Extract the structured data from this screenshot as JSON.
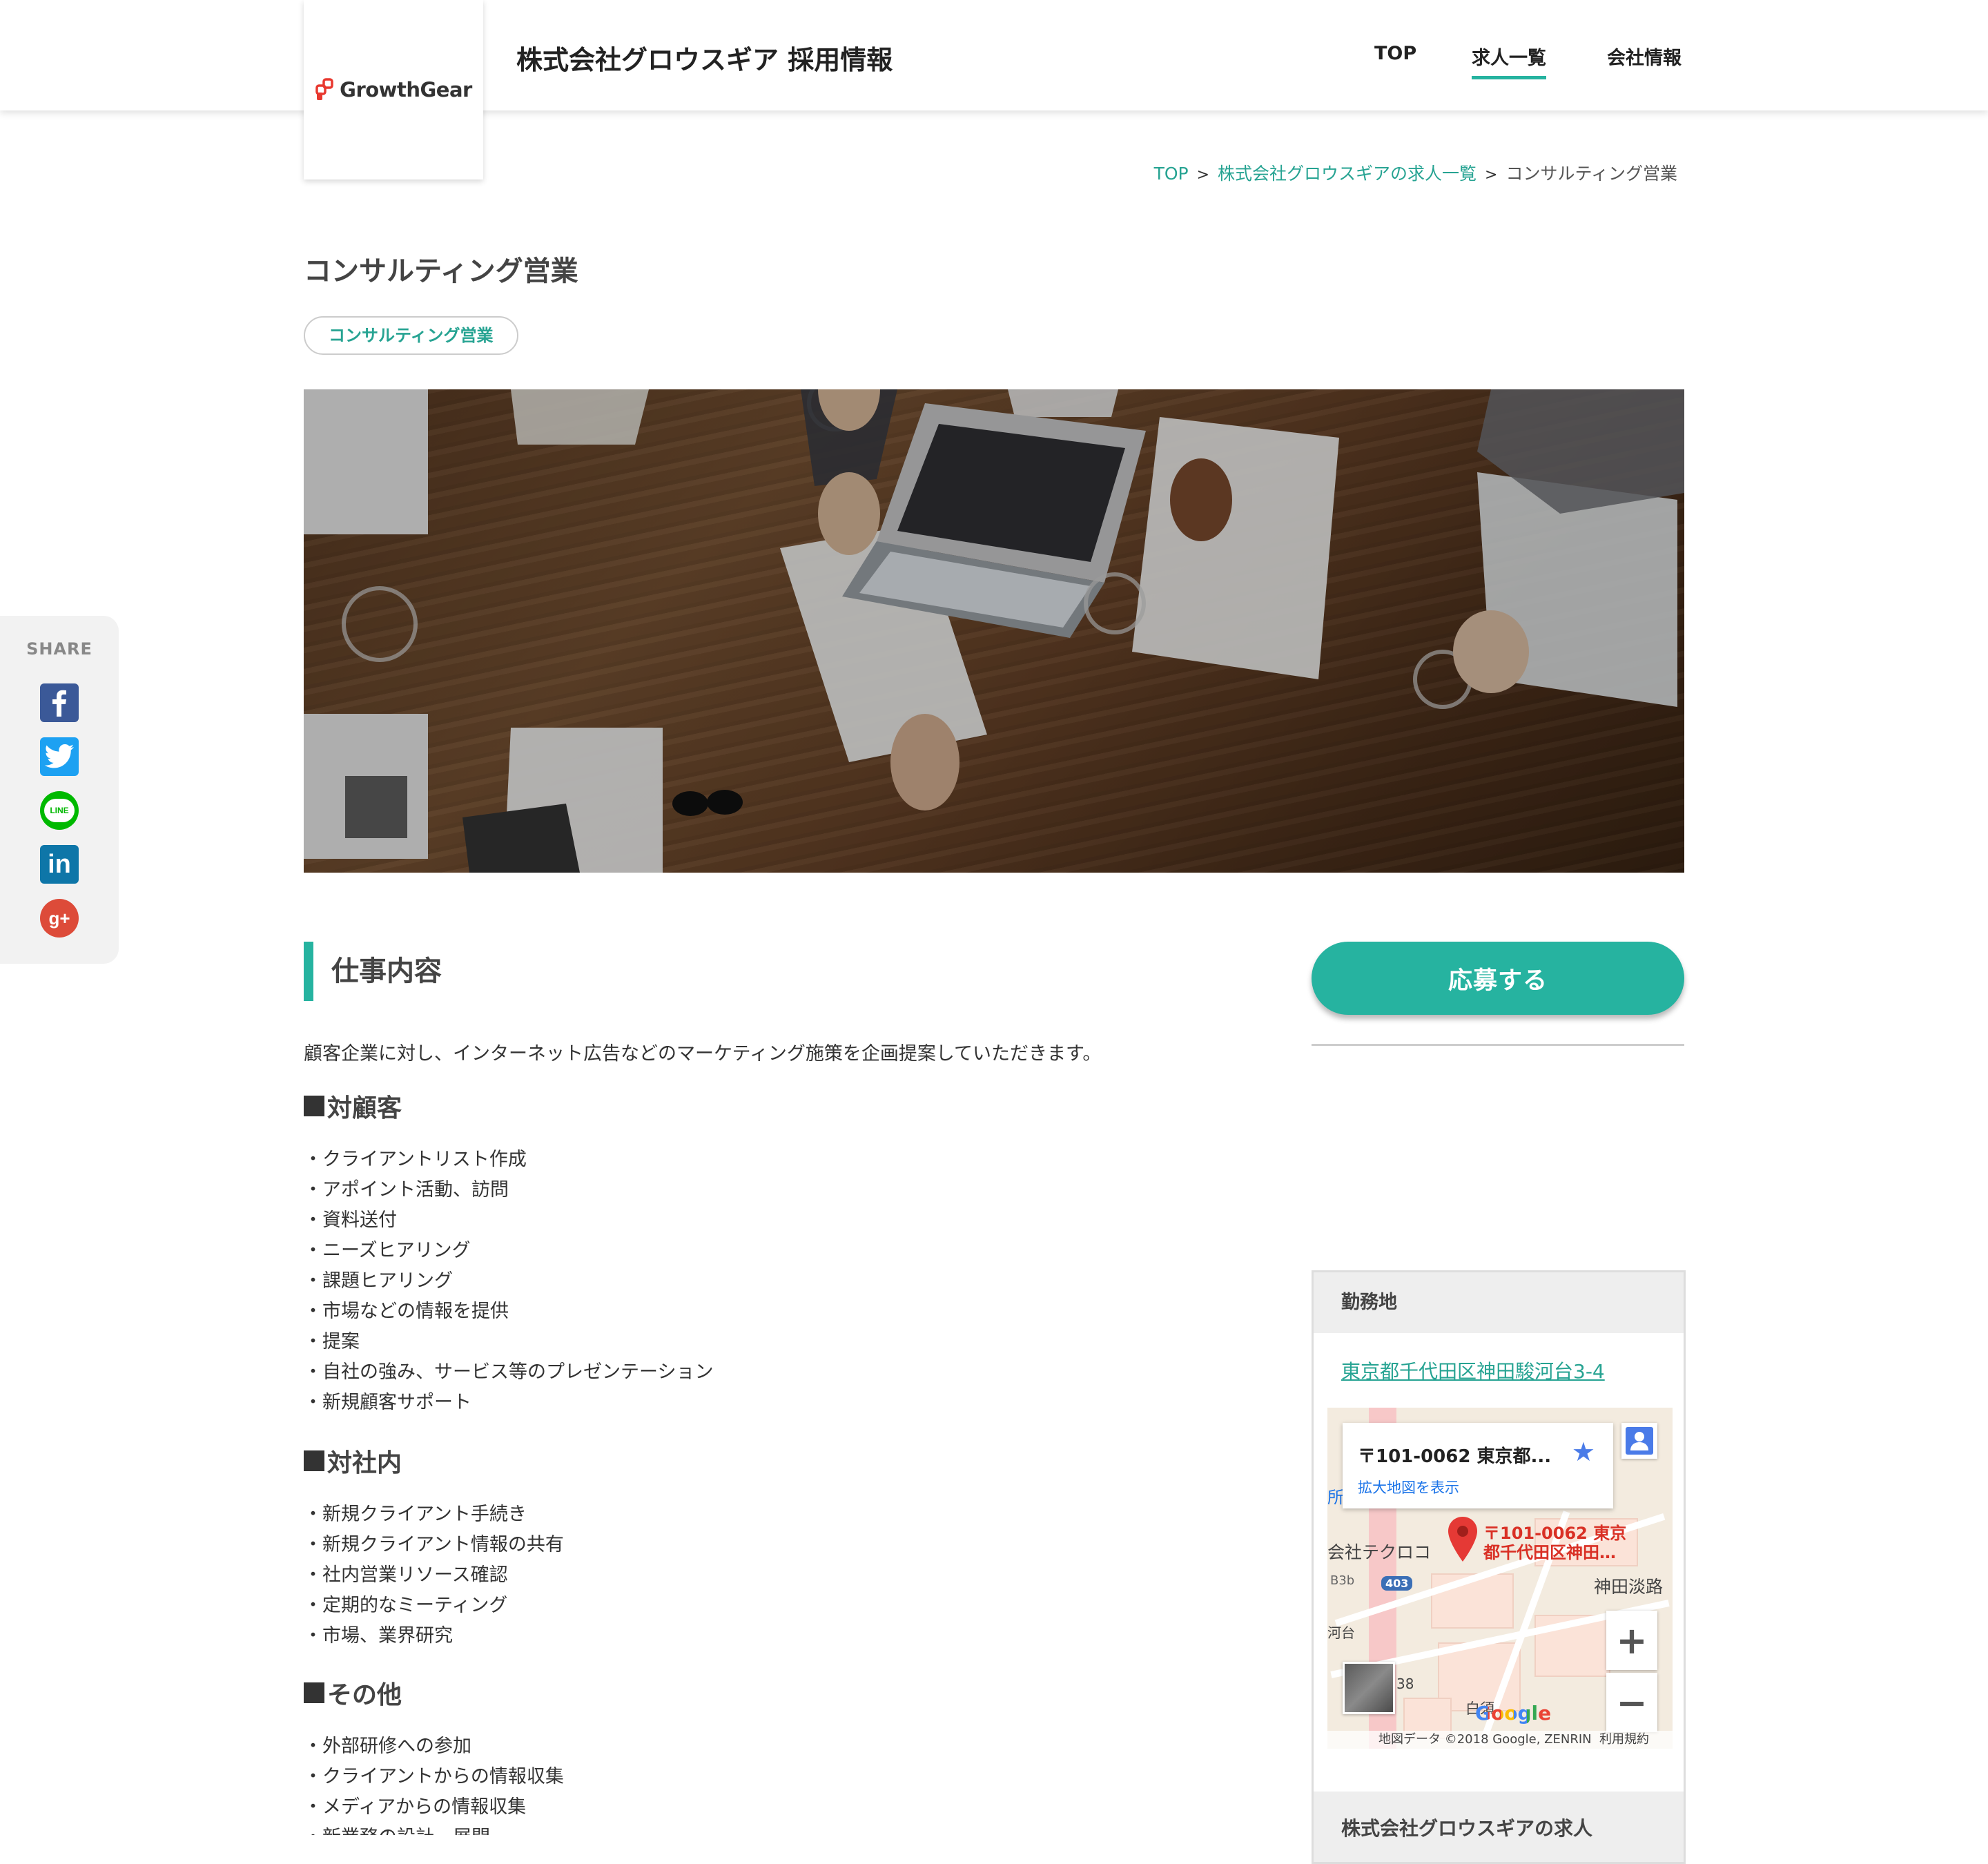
{
  "header": {
    "logo_text": "GrowthGear",
    "site_title": "株式会社グロウスギア 採用情報",
    "nav": [
      {
        "label": "TOP",
        "active": false
      },
      {
        "label": "求人一覧",
        "active": true
      },
      {
        "label": "会社情報",
        "active": false
      }
    ]
  },
  "breadcrumb": {
    "items": [
      "TOP",
      "株式会社グロウスギアの求人一覧"
    ],
    "separator": ">",
    "current": "コンサルティング営業"
  },
  "page": {
    "title": "コンサルティング営業",
    "tag": "コンサルティング営業"
  },
  "share": {
    "label": "SHARE",
    "icons": [
      "facebook-icon",
      "twitter-icon",
      "line-icon",
      "linkedin-icon",
      "google-plus-icon"
    ],
    "line_text": "LINE",
    "linkedin_text": "in",
    "googleplus_text": "g+"
  },
  "job": {
    "section_heading": "仕事内容",
    "intro": "顧客企業に対し、インターネット広告などのマーケティング施策を企画提案していただきます。",
    "groups": [
      {
        "heading": "対顧客",
        "items": [
          "・クライアントリスト作成",
          "・アポイント活動、訪問",
          "・資料送付",
          "・ニーズヒアリング",
          "・課題ヒアリング",
          "・市場などの情報を提供",
          "・提案",
          "・自社の強み、サービス等のプレゼンテーション",
          "・新規顧客サポート"
        ]
      },
      {
        "heading": "対社内",
        "items": [
          "・新規クライアント手続き",
          "・新規クライアント情報の共有",
          "・社内営業リソース確認",
          "・定期的なミーティング",
          "・市場、業界研究"
        ]
      },
      {
        "heading": "その他",
        "items": [
          "・外部研修への参加",
          "・クライアントからの情報収集",
          "・メディアからの情報収集",
          "・新業務の設計、展開"
        ]
      }
    ]
  },
  "sidebar": {
    "apply_label": "応募する",
    "location_heading": "勤務地",
    "address": "東京都千代田区神田駿河台3-4",
    "map": {
      "card_title": "〒101-0062 東京都...",
      "card_link": "拡大地図を表示",
      "pin_label": "〒101-0062 東京都千代田区神田…",
      "labels": [
        "会社テクロコ",
        "神田淡路",
        "白須",
        "403",
        "B3b",
        "河台",
        "所",
        "38"
      ],
      "zoom_in": "+",
      "zoom_out": "−",
      "google": "Google",
      "footer": "地図データ ©2018 Google, ZENRIN",
      "terms": "利用規約",
      "star": "★"
    },
    "jobs_heading": "株式会社グロウスギアの求人"
  },
  "colors": {
    "accent": "#26b3a0",
    "link": "#26a392",
    "facebook": "#3b5998",
    "twitter": "#1da1f2",
    "line": "#00b900",
    "linkedin": "#0e76a8",
    "googleplus": "#dd4b39"
  }
}
